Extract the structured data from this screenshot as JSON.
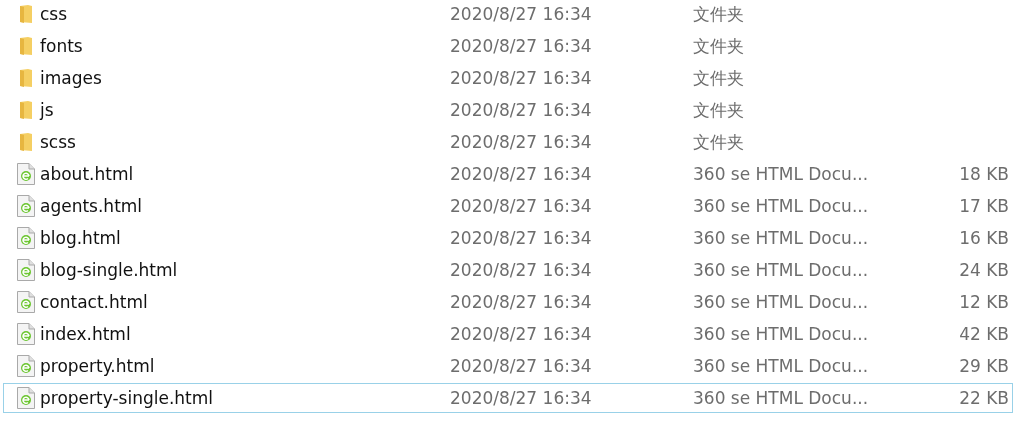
{
  "files": [
    {
      "kind": "folder",
      "name": "css",
      "modified": "2020/8/27 16:34",
      "type": "文件夹",
      "focused": false
    },
    {
      "kind": "folder",
      "name": "fonts",
      "modified": "2020/8/27 16:34",
      "type": "文件夹",
      "focused": false
    },
    {
      "kind": "folder",
      "name": "images",
      "modified": "2020/8/27 16:34",
      "type": "文件夹",
      "focused": false
    },
    {
      "kind": "folder",
      "name": "js",
      "modified": "2020/8/27 16:34",
      "type": "文件夹",
      "focused": false
    },
    {
      "kind": "folder",
      "name": "scss",
      "modified": "2020/8/27 16:34",
      "type": "文件夹",
      "focused": false
    },
    {
      "kind": "html",
      "name": "about.html",
      "modified": "2020/8/27 16:34",
      "type": "360 se HTML Docu...",
      "size": "18 KB",
      "focused": false
    },
    {
      "kind": "html",
      "name": "agents.html",
      "modified": "2020/8/27 16:34",
      "type": "360 se HTML Docu...",
      "size": "17 KB",
      "focused": false
    },
    {
      "kind": "html",
      "name": "blog.html",
      "modified": "2020/8/27 16:34",
      "type": "360 se HTML Docu...",
      "size": "16 KB",
      "focused": false
    },
    {
      "kind": "html",
      "name": "blog-single.html",
      "modified": "2020/8/27 16:34",
      "type": "360 se HTML Docu...",
      "size": "24 KB",
      "focused": false
    },
    {
      "kind": "html",
      "name": "contact.html",
      "modified": "2020/8/27 16:34",
      "type": "360 se HTML Docu...",
      "size": "12 KB",
      "focused": false
    },
    {
      "kind": "html",
      "name": "index.html",
      "modified": "2020/8/27 16:34",
      "type": "360 se HTML Docu...",
      "size": "42 KB",
      "focused": false
    },
    {
      "kind": "html",
      "name": "property.html",
      "modified": "2020/8/27 16:34",
      "type": "360 se HTML Docu...",
      "size": "29 KB",
      "focused": false
    },
    {
      "kind": "html",
      "name": "property-single.html",
      "modified": "2020/8/27 16:34",
      "type": "360 se HTML Docu...",
      "size": "22 KB",
      "focused": true
    }
  ]
}
